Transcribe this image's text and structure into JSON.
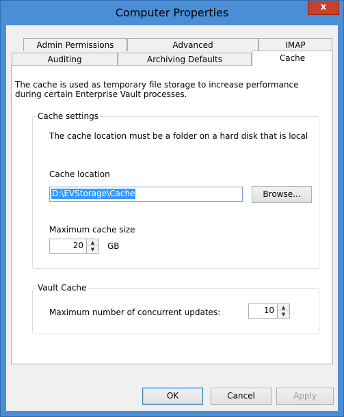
{
  "window": {
    "title": "Computer Properties",
    "close_glyph": "x"
  },
  "tabs_row1": [
    "Admin Permissions",
    "Advanced",
    "IMAP"
  ],
  "tabs_row2": [
    "Auditing",
    "Archiving Defaults",
    "Cache"
  ],
  "selected_tab": "Cache",
  "description": "The cache is used as temporary file storage to increase performance during certain Enterprise Vault processes.",
  "cache_settings": {
    "title": "Cache settings",
    "note": "The cache location must be a folder on a hard disk that is local",
    "location_label": "Cache location",
    "location_value": "D:\\EVStorage\\Cache",
    "browse_label": "Browse...",
    "max_size_label": "Maximum cache size",
    "max_size_value": "20",
    "max_size_unit": "GB"
  },
  "vault_cache": {
    "title": "Vault Cache",
    "concurrent_label": "Maximum number of concurrent updates:",
    "concurrent_value": "10"
  },
  "footer": {
    "ok_label": "OK",
    "cancel_label": "Cancel",
    "apply_label": "Apply"
  },
  "icons": {
    "spin_up": "▲",
    "spin_down": "▼"
  }
}
